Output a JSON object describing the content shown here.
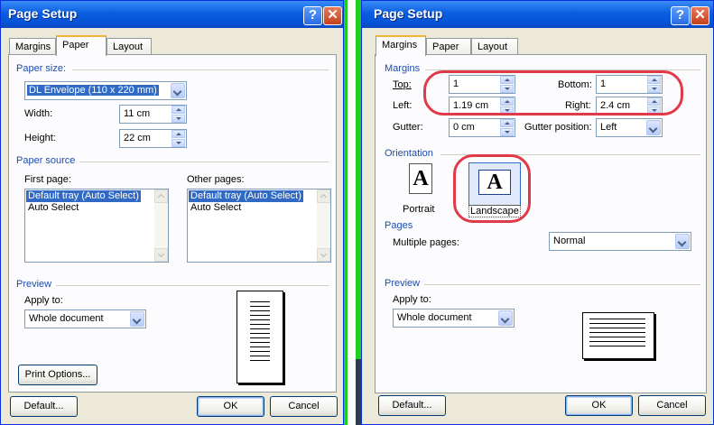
{
  "left_dialog": {
    "title": "Page Setup",
    "help_glyph": "?",
    "close_glyph": "✕",
    "tabs": [
      {
        "label": "Margins"
      },
      {
        "label": "Paper"
      },
      {
        "label": "Layout"
      }
    ],
    "active_tab": "Paper",
    "paper_size": {
      "group_label": "Paper size:",
      "selected": "DL Envelope (110 x 220 mm)",
      "width_label": "Width:",
      "width_value": "11 cm",
      "height_label": "Height:",
      "height_value": "22 cm"
    },
    "paper_source": {
      "group_label": "Paper source",
      "first_page_label": "First page:",
      "first_page_items": [
        "Default tray (Auto Select)",
        "Auto Select"
      ],
      "other_pages_label": "Other pages:",
      "other_pages_items": [
        "Default tray (Auto Select)",
        "Auto Select"
      ]
    },
    "preview": {
      "group_label": "Preview",
      "apply_to_label": "Apply to:",
      "apply_to_value": "Whole document",
      "print_options_label": "Print Options..."
    },
    "buttons": {
      "default": "Default...",
      "ok": "OK",
      "cancel": "Cancel"
    }
  },
  "right_dialog": {
    "title": "Page Setup",
    "help_glyph": "?",
    "close_glyph": "✕",
    "tabs": [
      {
        "label": "Margins"
      },
      {
        "label": "Paper"
      },
      {
        "label": "Layout"
      }
    ],
    "active_tab": "Margins",
    "margins": {
      "group_label": "Margins",
      "top_label": "Top:",
      "top_value": "1",
      "bottom_label": "Bottom:",
      "bottom_value": "1",
      "left_label": "Left:",
      "left_value": "1.19 cm",
      "right_label": "Right:",
      "right_value": "2.4 cm",
      "gutter_label": "Gutter:",
      "gutter_value": "0 cm",
      "gutter_position_label": "Gutter position:",
      "gutter_position_value": "Left"
    },
    "orientation": {
      "group_label": "Orientation",
      "portrait_label": "Portrait",
      "landscape_label": "Landscape",
      "icon_glyph": "A",
      "selected": "Landscape"
    },
    "pages": {
      "group_label": "Pages",
      "multiple_pages_label": "Multiple pages:",
      "multiple_pages_value": "Normal"
    },
    "preview": {
      "group_label": "Preview",
      "apply_to_label": "Apply to:",
      "apply_to_value": "Whole document"
    },
    "buttons": {
      "default": "Default...",
      "ok": "OK",
      "cancel": "Cancel"
    }
  },
  "colors": {
    "highlight_oval": "#e03a48",
    "titlebar": "#0a5ee0",
    "group_title": "#1e4ca8",
    "selection": "#316ac5",
    "separator": "#1fd11f"
  }
}
